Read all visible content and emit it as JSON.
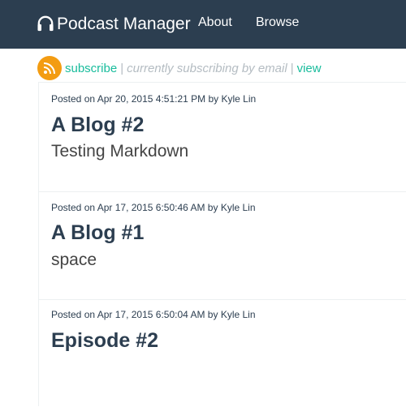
{
  "navbar": {
    "brand": "Podcast Manager",
    "brand_icon": "headphones-icon",
    "links": [
      {
        "label": "About"
      },
      {
        "label": "Browse"
      }
    ]
  },
  "subscription": {
    "icon": "rss-icon",
    "subscribe_label": "subscribe",
    "separator": "|",
    "status": "currently subscribing by email",
    "view_label": "view"
  },
  "posts": [
    {
      "meta": "Posted on Apr 20, 2015 4:51:21 PM by Kyle Lin",
      "title": "A Blog #2",
      "summary": "Testing Markdown"
    },
    {
      "meta": "Posted on Apr 17, 2015 6:50:46 AM by Kyle Lin",
      "title": "A Blog #1",
      "summary": "space"
    },
    {
      "meta": "Posted on Apr 17, 2015 6:50:04 AM by Kyle Lin",
      "title": "Episode #2",
      "summary": ""
    }
  ],
  "colors": {
    "navbar": "#2c3e50",
    "accent": "#18bc9c",
    "rss": "#f39c12"
  }
}
